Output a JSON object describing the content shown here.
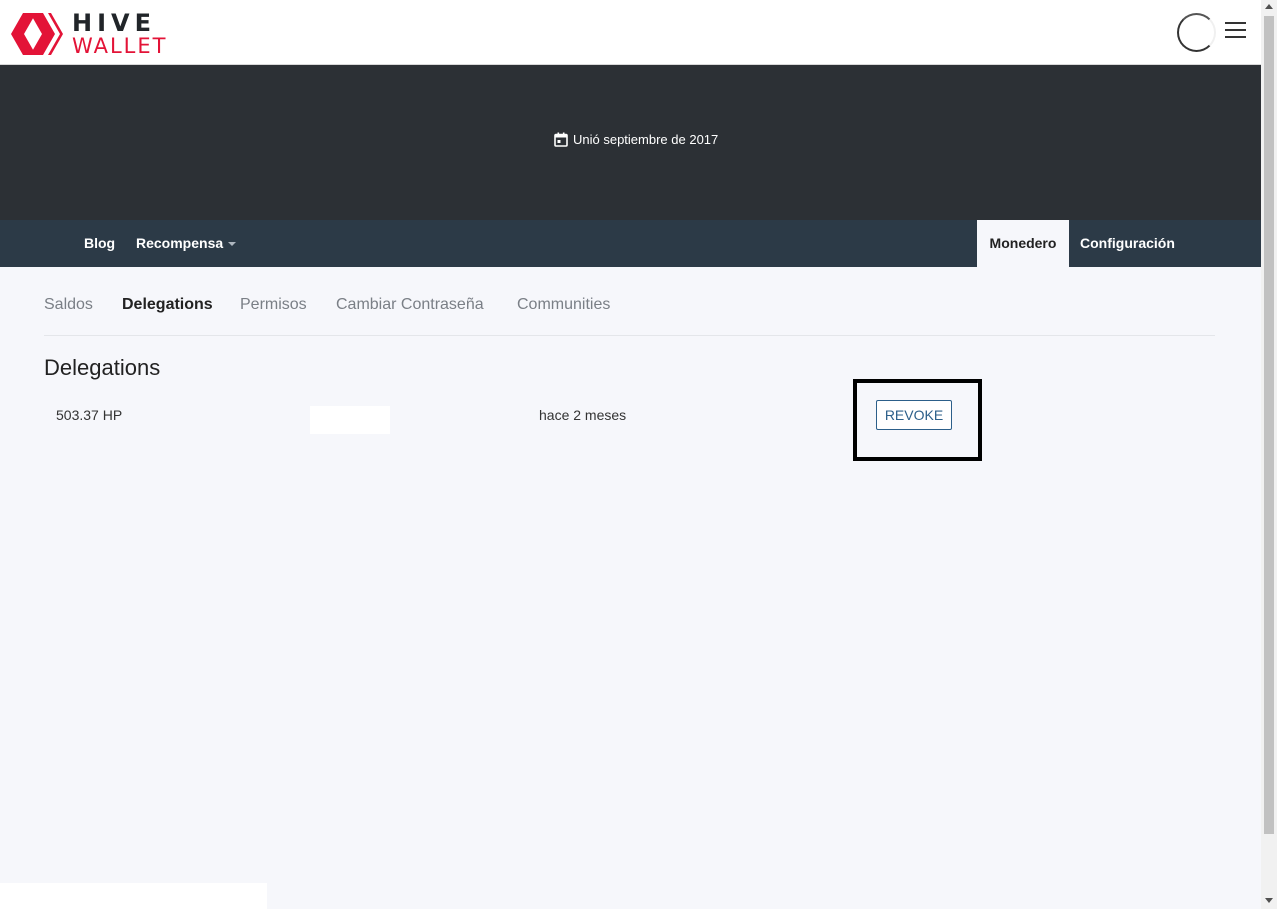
{
  "header": {
    "logo_top": "HIVE",
    "logo_bottom": "WALLET",
    "brand_color": "#e31337"
  },
  "cover": {
    "joined_text": "Unió septiembre de 2017",
    "icon": "calendar-icon"
  },
  "nav": {
    "blog": "Blog",
    "recompensa": "Recompensa",
    "monedero": "Monedero",
    "configuracion": "Configuración"
  },
  "subtabs": [
    "Saldos",
    "Delegations",
    "Permisos",
    "Cambiar Contraseña",
    "Communities"
  ],
  "active_subtab": "Delegations",
  "section": {
    "title": "Delegations"
  },
  "delegation": {
    "amount": "503.37 HP",
    "delegatee": "",
    "time": "hace 2 meses",
    "revoke_label": "REVOKE"
  }
}
